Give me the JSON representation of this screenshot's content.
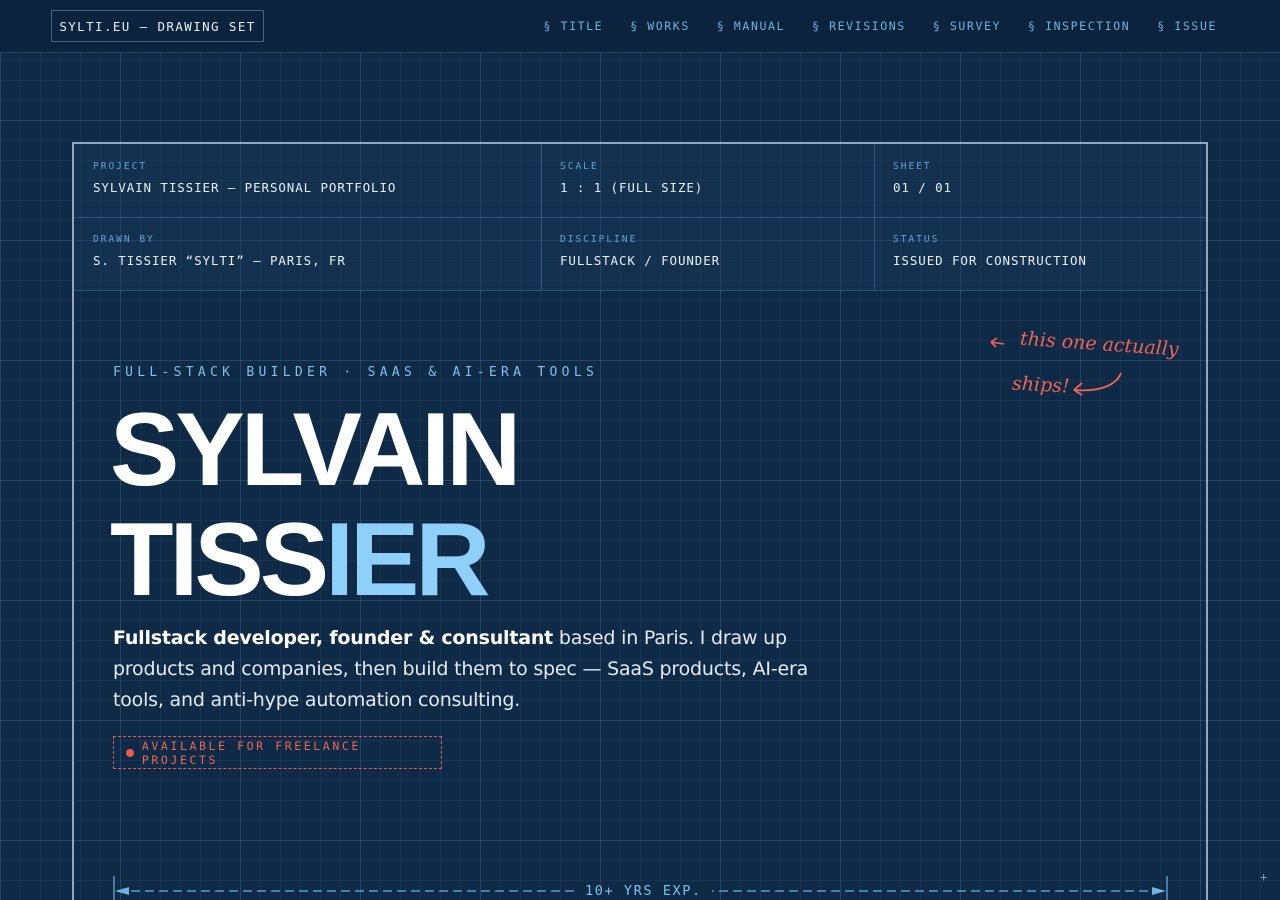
{
  "brand": "SYLTI.EU — DRAWING SET",
  "nav": [
    "§ TITLE",
    "§ WORKS",
    "§ MANUAL",
    "§ REVISIONS",
    "§ SURVEY",
    "§ INSPECTION",
    "§ ISSUE"
  ],
  "titleblock": {
    "project_label": "PROJECT",
    "project": "SYLVAIN TISSIER — PERSONAL PORTFOLIO",
    "scale_label": "SCALE",
    "scale": "1 : 1 (FULL SIZE)",
    "sheet_label": "SHEET",
    "sheet": "01 / 01",
    "drawn_label": "DRAWN BY",
    "drawn": "S. TISSIER “SYLTI” — PARIS, FR",
    "discipline_label": "DISCIPLINE",
    "discipline": "FULLSTACK / FOUNDER",
    "status_label": "STATUS",
    "status": "ISSUED FOR CONSTRUCTION"
  },
  "hero": {
    "kicker": "FULL-STACK BUILDER · SAAS & AI-ERA TOOLS",
    "name_line1": "SYLVAIN",
    "name_line2_a": "TISS",
    "name_line2_b": "IER",
    "intro_bold": "Fullstack developer, founder & consultant",
    "intro_rest": " based in Paris. I draw up products and companies, then build them to spec — SaaS products, AI-era tools, and anti-hype automation consulting.",
    "availability": "AVAILABLE FOR FREELANCE PROJECTS"
  },
  "annotation": {
    "line1": "this one actually",
    "line2": "ships!"
  },
  "dimension_label": "10+ YRS EXP.",
  "corner_mark": "+",
  "colors": {
    "background": "#0f2a47",
    "accent_blue": "#8fd0fb",
    "accent_red": "#ef6453"
  }
}
